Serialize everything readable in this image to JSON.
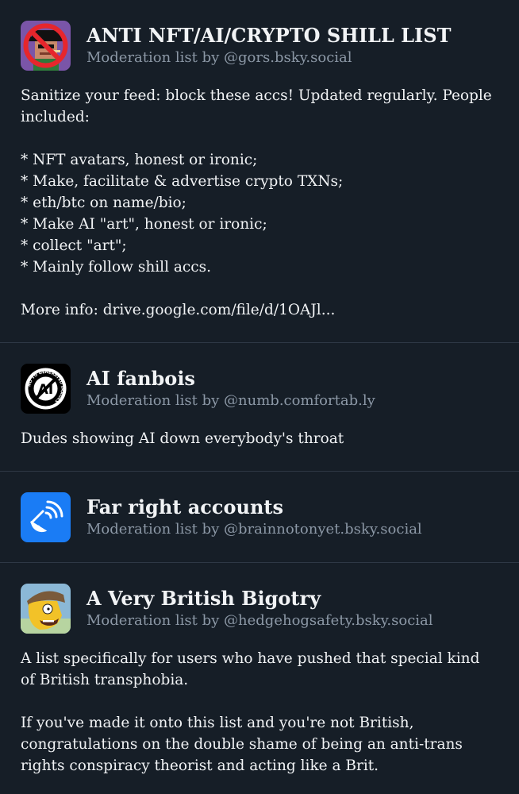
{
  "lists": [
    {
      "title": "ANTI NFT/AI/CRYPTO SHILL LIST",
      "byline": "Moderation list by @gors.bsky.social",
      "description": "Sanitize your feed: block these accs! Updated regularly. People included:\n\n* NFT avatars, honest or ironic;\n* Make, facilitate & advertise crypto TXNs;\n* eth/btc on name/bio;\n* Make AI \"art\", honest or ironic;\n* collect \"art\";\n* Mainly follow shill accs.\n\nMore info: ",
      "link": "drive.google.com/file/d/1OAJl..."
    },
    {
      "title": "AI fanbois",
      "byline": "Moderation list by @numb.comfortab.ly",
      "description": "Dudes showing AI down everybody's throat",
      "avatar_text": "NO TO GENERATED IMAGES"
    },
    {
      "title": "Far right accounts",
      "byline": "Moderation list by @brainnotonyet.bsky.social",
      "description": ""
    },
    {
      "title": "A Very British Bigotry",
      "byline": "Moderation list by @hedgehogsafety.bsky.social",
      "description": "A list specifically for users who have pushed that special kind of British transphobia.\n\nIf you've made it onto this list and you're not British, congratulations on the double shame of being an anti-trans rights conspiracy theorist and acting like a Brit."
    }
  ],
  "colors": {
    "background": "#161e27",
    "divider": "#2e3845",
    "text": "#f1f3f5",
    "muted": "#8c98a6",
    "list_avatar_blue": "#1a7cf5"
  }
}
